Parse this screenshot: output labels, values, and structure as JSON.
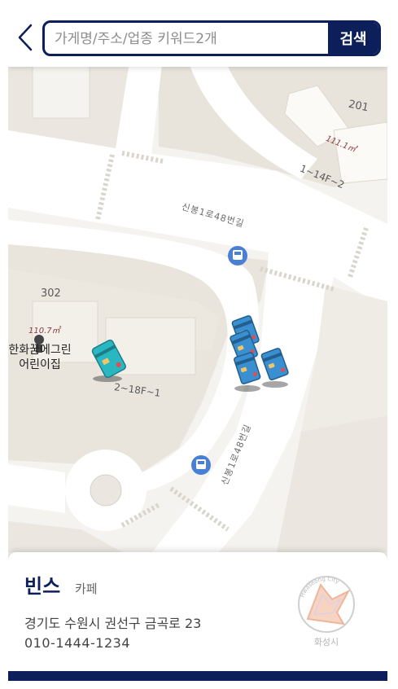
{
  "search": {
    "placeholder": "가게명/주소/업종 키워드2개",
    "button_label": "검색"
  },
  "map": {
    "roads": [
      "신봉1로48번길",
      "신봉1로48번길"
    ],
    "building_numbers": [
      "201",
      "302"
    ],
    "area_labels": [
      "111.1㎡",
      "110.7㎡"
    ],
    "floor_labels": [
      "1~14F~2",
      "2~18F~1"
    ],
    "poi": {
      "line1": "한화꿈에그린",
      "line2": "어린이집"
    }
  },
  "store": {
    "name": "빈스",
    "category": "카페",
    "address": "경기도 수원시 권선구 금곡로 23",
    "phone": "010-1444-1234"
  },
  "logo": {
    "text": "화성시",
    "arc_text": "Hwaseong City"
  },
  "colors": {
    "brand": "#0c1f5a",
    "marker_teal": "#2bb7c2",
    "marker_blue": "#3a8fd0",
    "bus_stop": "#4a7fd6"
  }
}
